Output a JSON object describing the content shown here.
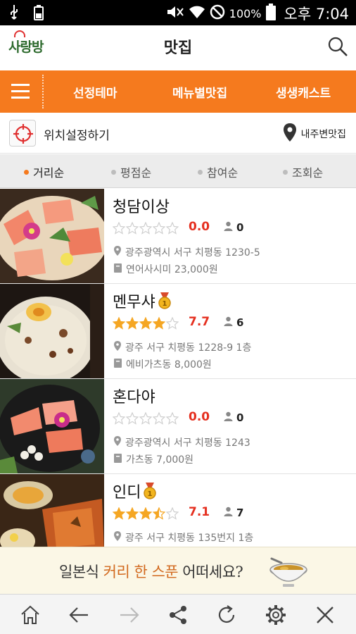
{
  "status_bar": {
    "icons": [
      "usb-icon",
      "battery-saver-icon",
      "mute-icon",
      "wifi-icon",
      "block-icon",
      "battery-icon"
    ],
    "battery": "100%",
    "time": "오후 7:04"
  },
  "header": {
    "logo": "사랑방",
    "title": "맛집",
    "search_icon": "search-icon"
  },
  "nav": {
    "menu_icon": "hamburger-icon",
    "tabs": [
      "선정테마",
      "메뉴별맛집",
      "생생캐스트"
    ]
  },
  "location": {
    "set_label": "위치설정하기",
    "nearby_label": "내주변맛집"
  },
  "sort": {
    "options": [
      "거리순",
      "평점순",
      "참여순",
      "조회순"
    ],
    "active": "거리순"
  },
  "restaurants": [
    {
      "name": "청담이상",
      "medal": false,
      "rating_stars": 0,
      "score": "0.0",
      "participants": "0",
      "address": "광주광역시 서구 치평동 1230-5",
      "menu": "연어사시미 23,000원"
    },
    {
      "name": "멘무샤",
      "medal": true,
      "rating_stars": 4,
      "score": "7.7",
      "participants": "6",
      "address": "광주 서구 치평동 1228-9 1층",
      "menu": "에비가츠동 8,000원"
    },
    {
      "name": "혼다야",
      "medal": false,
      "rating_stars": 0,
      "score": "0.0",
      "participants": "0",
      "address": "광주광역시 서구 치평동 1243",
      "menu": "가츠동 7,000원"
    },
    {
      "name": "인디",
      "medal": true,
      "rating_stars": 3.5,
      "score": "7.1",
      "participants": "7",
      "address": "광주 서구 치평동 135번지 1층",
      "menu": ""
    }
  ],
  "ad": {
    "text_before": "일본식 ",
    "text_highlight": "커리 한 스푼",
    "text_after": " 어떠세요?"
  },
  "toolbar": {
    "icons": [
      "home-icon",
      "back-icon",
      "forward-icon",
      "share-icon",
      "refresh-icon",
      "settings-icon",
      "close-icon"
    ]
  },
  "colors": {
    "accent": "#f57a1e",
    "score": "#e53020",
    "star": "#f5a623"
  }
}
